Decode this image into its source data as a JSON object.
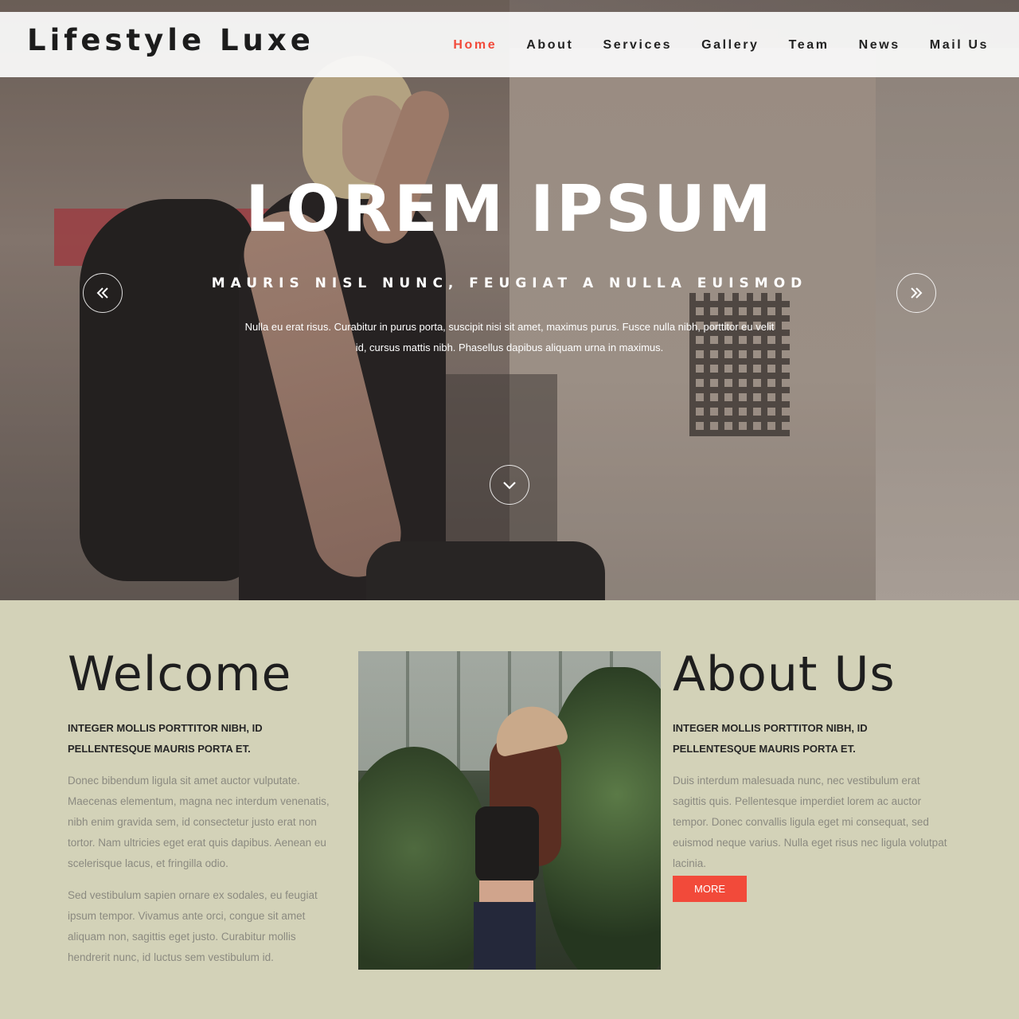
{
  "brand": {
    "logo": "Lifestyle Luxe"
  },
  "nav": {
    "items": [
      {
        "label": "Home",
        "active": true
      },
      {
        "label": "About",
        "active": false
      },
      {
        "label": "Services",
        "active": false
      },
      {
        "label": "Gallery",
        "active": false
      },
      {
        "label": "Team",
        "active": false
      },
      {
        "label": "News",
        "active": false
      },
      {
        "label": "Mail Us",
        "active": false
      }
    ]
  },
  "hero": {
    "title": "LOREM IPSUM",
    "subtitle": "MAURIS NISL NUNC, FEUGIAT A NULLA EUISMOD",
    "text": "Nulla eu erat risus. Curabitur in purus porta, suscipit nisi sit amet, maximus purus. Fusce nulla nibh, porttitor eu velit id, cursus mattis nibh. Phasellus dapibus aliquam urna in maximus.",
    "prev_icon": "double-chevron-left-icon",
    "next_icon": "double-chevron-right-icon",
    "scroll_icon": "chevron-down-icon"
  },
  "welcome": {
    "title": "Welcome",
    "lead": "INTEGER MOLLIS PORTTITOR NIBH, ID PELLENTESQUE MAURIS PORTA ET.",
    "p1": "Donec bibendum ligula sit amet auctor vulputate. Maecenas elementum, magna nec interdum venenatis, nibh enim gravida sem, id consectetur justo erat non tortor. Nam ultricies eget erat quis dapibus. Aenean eu scelerisque lacus, et fringilla odio.",
    "p2": "Sed vestibulum sapien ornare ex sodales, eu feugiat ipsum tempor. Vivamus ante orci, congue sit amet aliquam non, sagittis eget justo. Curabitur mollis hendrerit nunc, id luctus sem vestibulum id."
  },
  "about": {
    "title": "About Us",
    "lead": "INTEGER MOLLIS PORTTITOR NIBH, ID PELLENTESQUE MAURIS PORTA ET.",
    "p1": "Duis interdum malesuada nunc, nec vestibulum erat sagittis quis. Pellentesque imperdiet lorem ac auctor tempor. Donec convallis ligula eget mi consequat, sed euismod neque varius. Nulla eget risus nec ligula volutpat lacinia.",
    "button": "MORE"
  },
  "colors": {
    "accent": "#f24a3a",
    "content_bg": "#d3d2b8",
    "header_bg": "#fafafa",
    "text_dark": "#1e1e1e",
    "text_muted": "#8b8a80"
  }
}
